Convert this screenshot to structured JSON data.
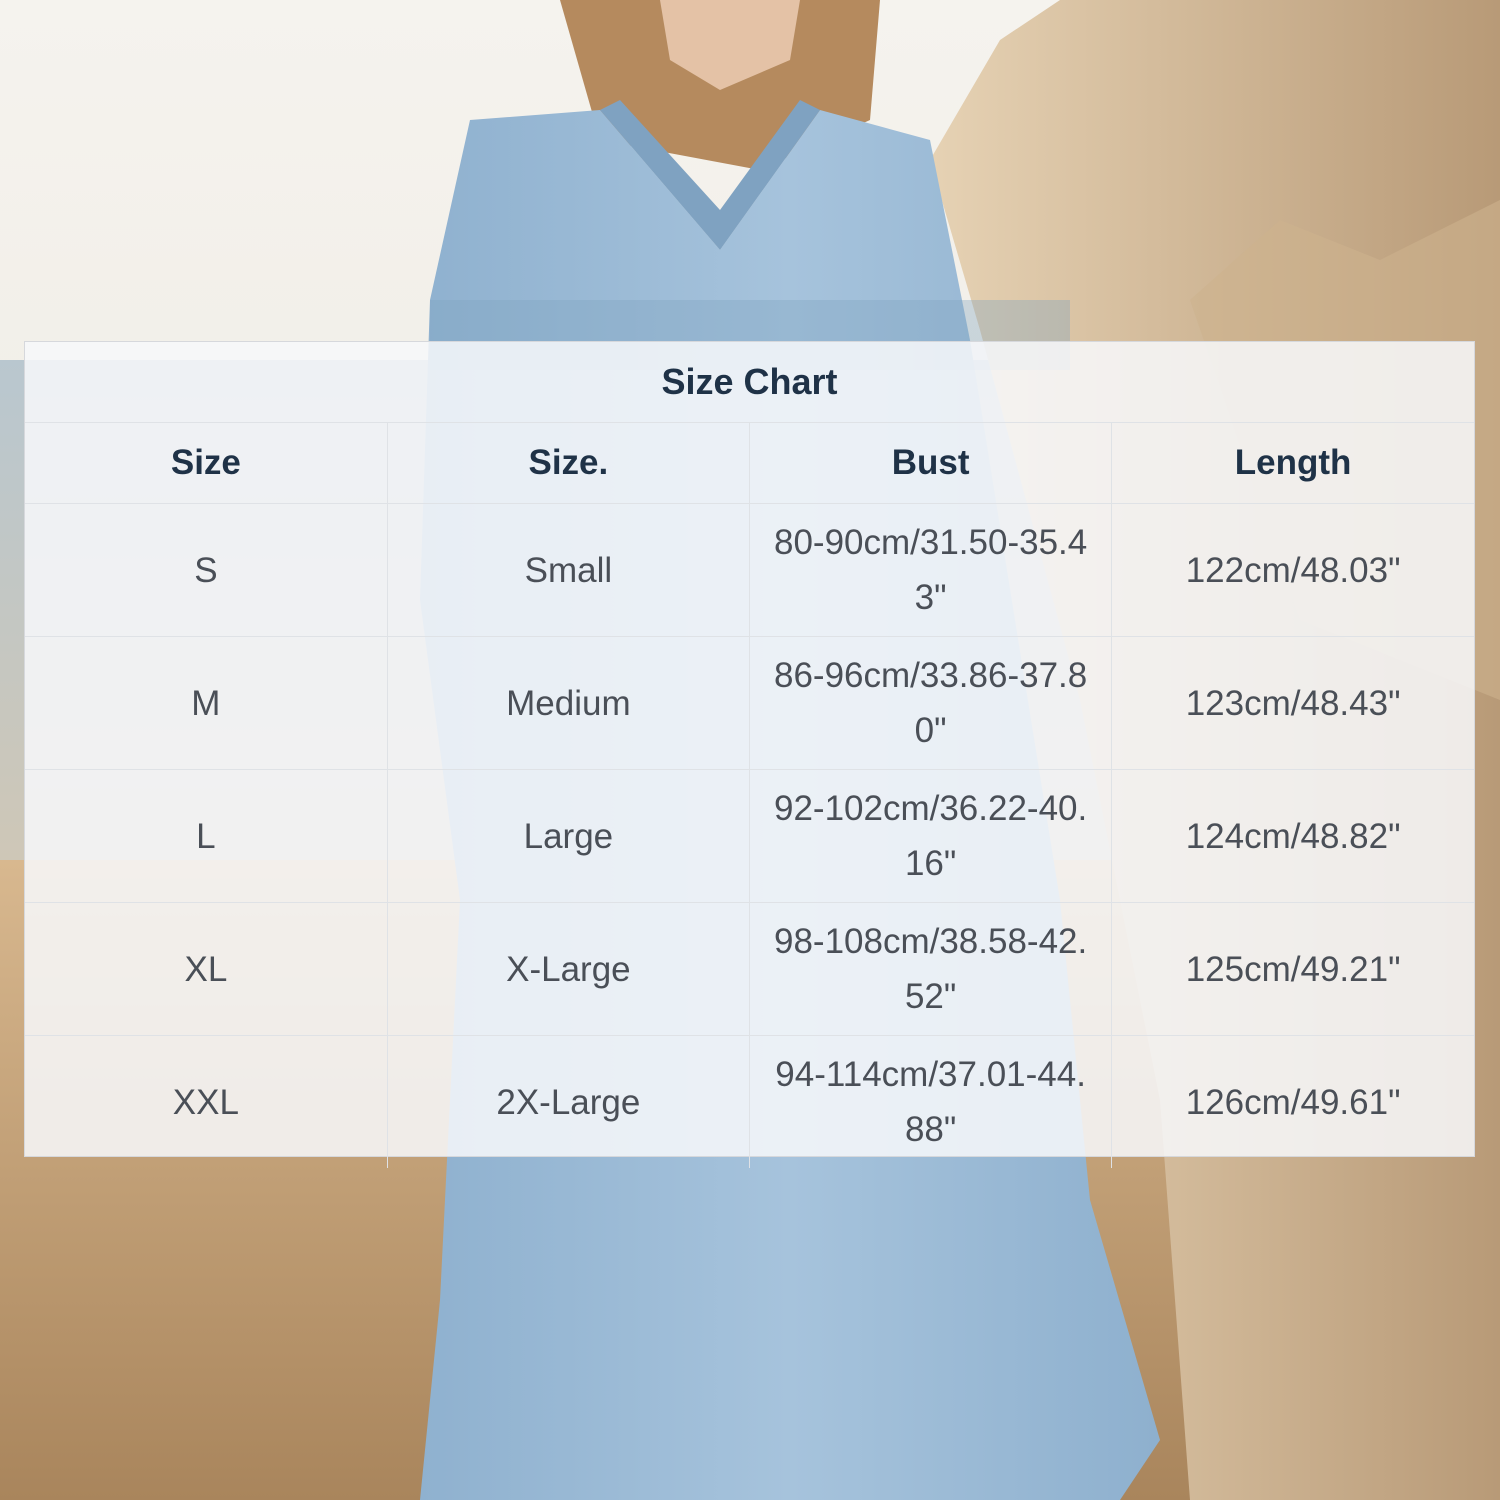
{
  "chart": {
    "title": "Size Chart",
    "headers": [
      "Size",
      "Size.",
      "Bust",
      "Length"
    ],
    "rows": [
      [
        "S",
        "Small",
        "80-90cm/31.50-35.43\"",
        "122cm/48.03\""
      ],
      [
        "M",
        "Medium",
        "86-96cm/33.86-37.80\"",
        "123cm/48.43\""
      ],
      [
        "L",
        "Large",
        "92-102cm/36.22-40.16\"",
        "124cm/48.82\""
      ],
      [
        "XL",
        "X-Large",
        "98-108cm/38.58-42.52\"",
        "125cm/49.21\""
      ],
      [
        "XXL",
        "2X-Large",
        "94-114cm/37.01-44.88\"",
        "126cm/49.61\""
      ]
    ]
  },
  "colors": {
    "heading_text": "#1f3247",
    "body_text": "#4a4f57",
    "dress": "#9dbbd6",
    "sand": "#c9a274",
    "rock": "#d9c2a2"
  }
}
